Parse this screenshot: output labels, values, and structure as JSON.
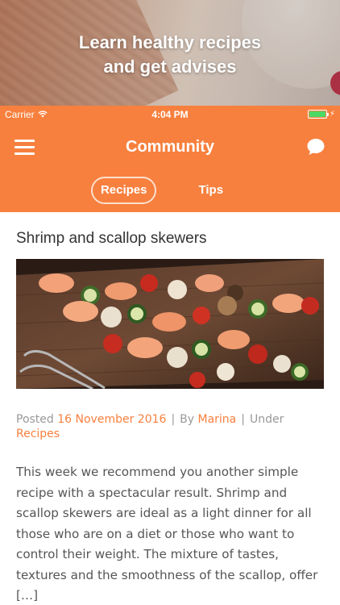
{
  "promo": {
    "line1": "Learn healthy recipes",
    "line2": "and get advises"
  },
  "status_bar": {
    "carrier": "Carrier",
    "time": "4:04 PM",
    "battery_color": "#4cd964"
  },
  "navbar": {
    "title": "Community",
    "left_icon": "menu-icon",
    "right_icon": "chat-bubble-icon"
  },
  "tabs": [
    {
      "label": "Recipes",
      "active": true
    },
    {
      "label": "Tips",
      "active": false
    }
  ],
  "article": {
    "title": "Shrimp and scallop skewers",
    "meta": {
      "posted_label": "Posted",
      "date": "16 November 2016",
      "separator": "|",
      "by_label": "By",
      "author": "Marina",
      "under_label": "Under",
      "category": "Recipes"
    },
    "excerpt": "This week we recommend you another simple recipe with a spectacular result. Shrimp and scallop skewers are ideal as a light dinner for all those who are on a diet or those who want to control their weight. The mixture of tastes, textures and the smoothness of the scallop, offer […]"
  },
  "colors": {
    "accent": "#f7803e",
    "title_text": "#333333",
    "body_text": "#555555",
    "meta_text": "#999999"
  }
}
